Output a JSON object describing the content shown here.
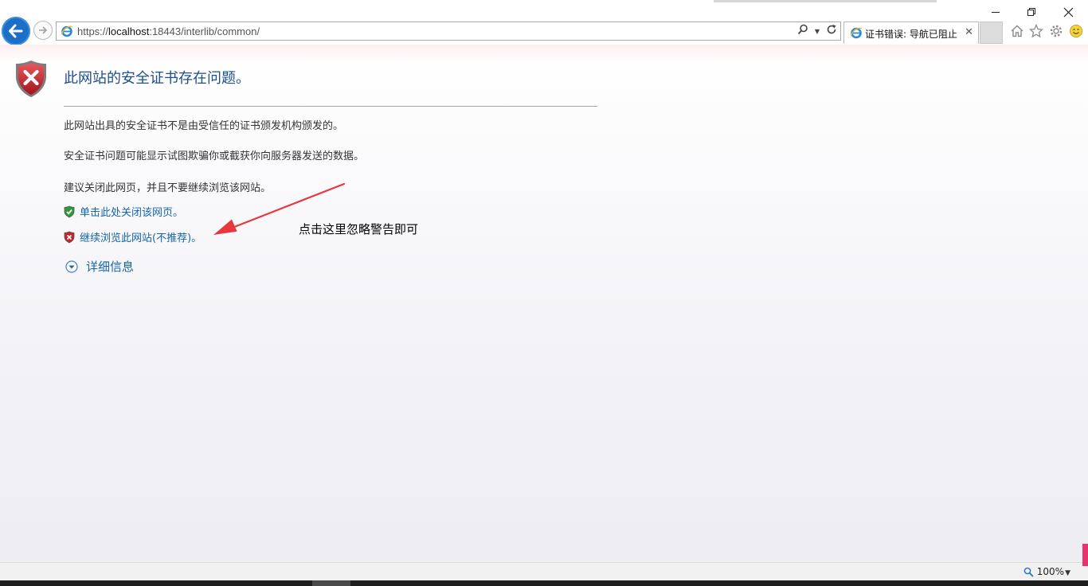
{
  "browser": {
    "url_prefix": "https://",
    "url_host": "localhost",
    "url_rest": ":18443/interlib/common/",
    "tab_title": "证书错误: 导航已阻止",
    "zoom": "100%"
  },
  "page": {
    "title": "此网站的安全证书存在问题。",
    "para1": "此网站出具的安全证书不是由受信任的证书颁发机构颁发的。",
    "para2": "安全证书问题可能显示试图欺骗你或截获你向服务器发送的数据。",
    "para3": "建议关闭此网页，并且不要继续浏览该网站。",
    "link_close": "单击此处关闭该网页。",
    "link_continue": "继续浏览此网站(不推荐)。",
    "details": "详细信息"
  },
  "annotation": {
    "text": "点击这里忽略警告即可",
    "color": "#e8383d"
  },
  "icons": {
    "back": "back-arrow-icon",
    "forward": "forward-arrow-icon",
    "search": "search-icon",
    "refresh": "refresh-icon",
    "home": "home-icon",
    "favorites": "star-icon",
    "tools": "gear-icon",
    "feedback": "smiley-icon"
  }
}
